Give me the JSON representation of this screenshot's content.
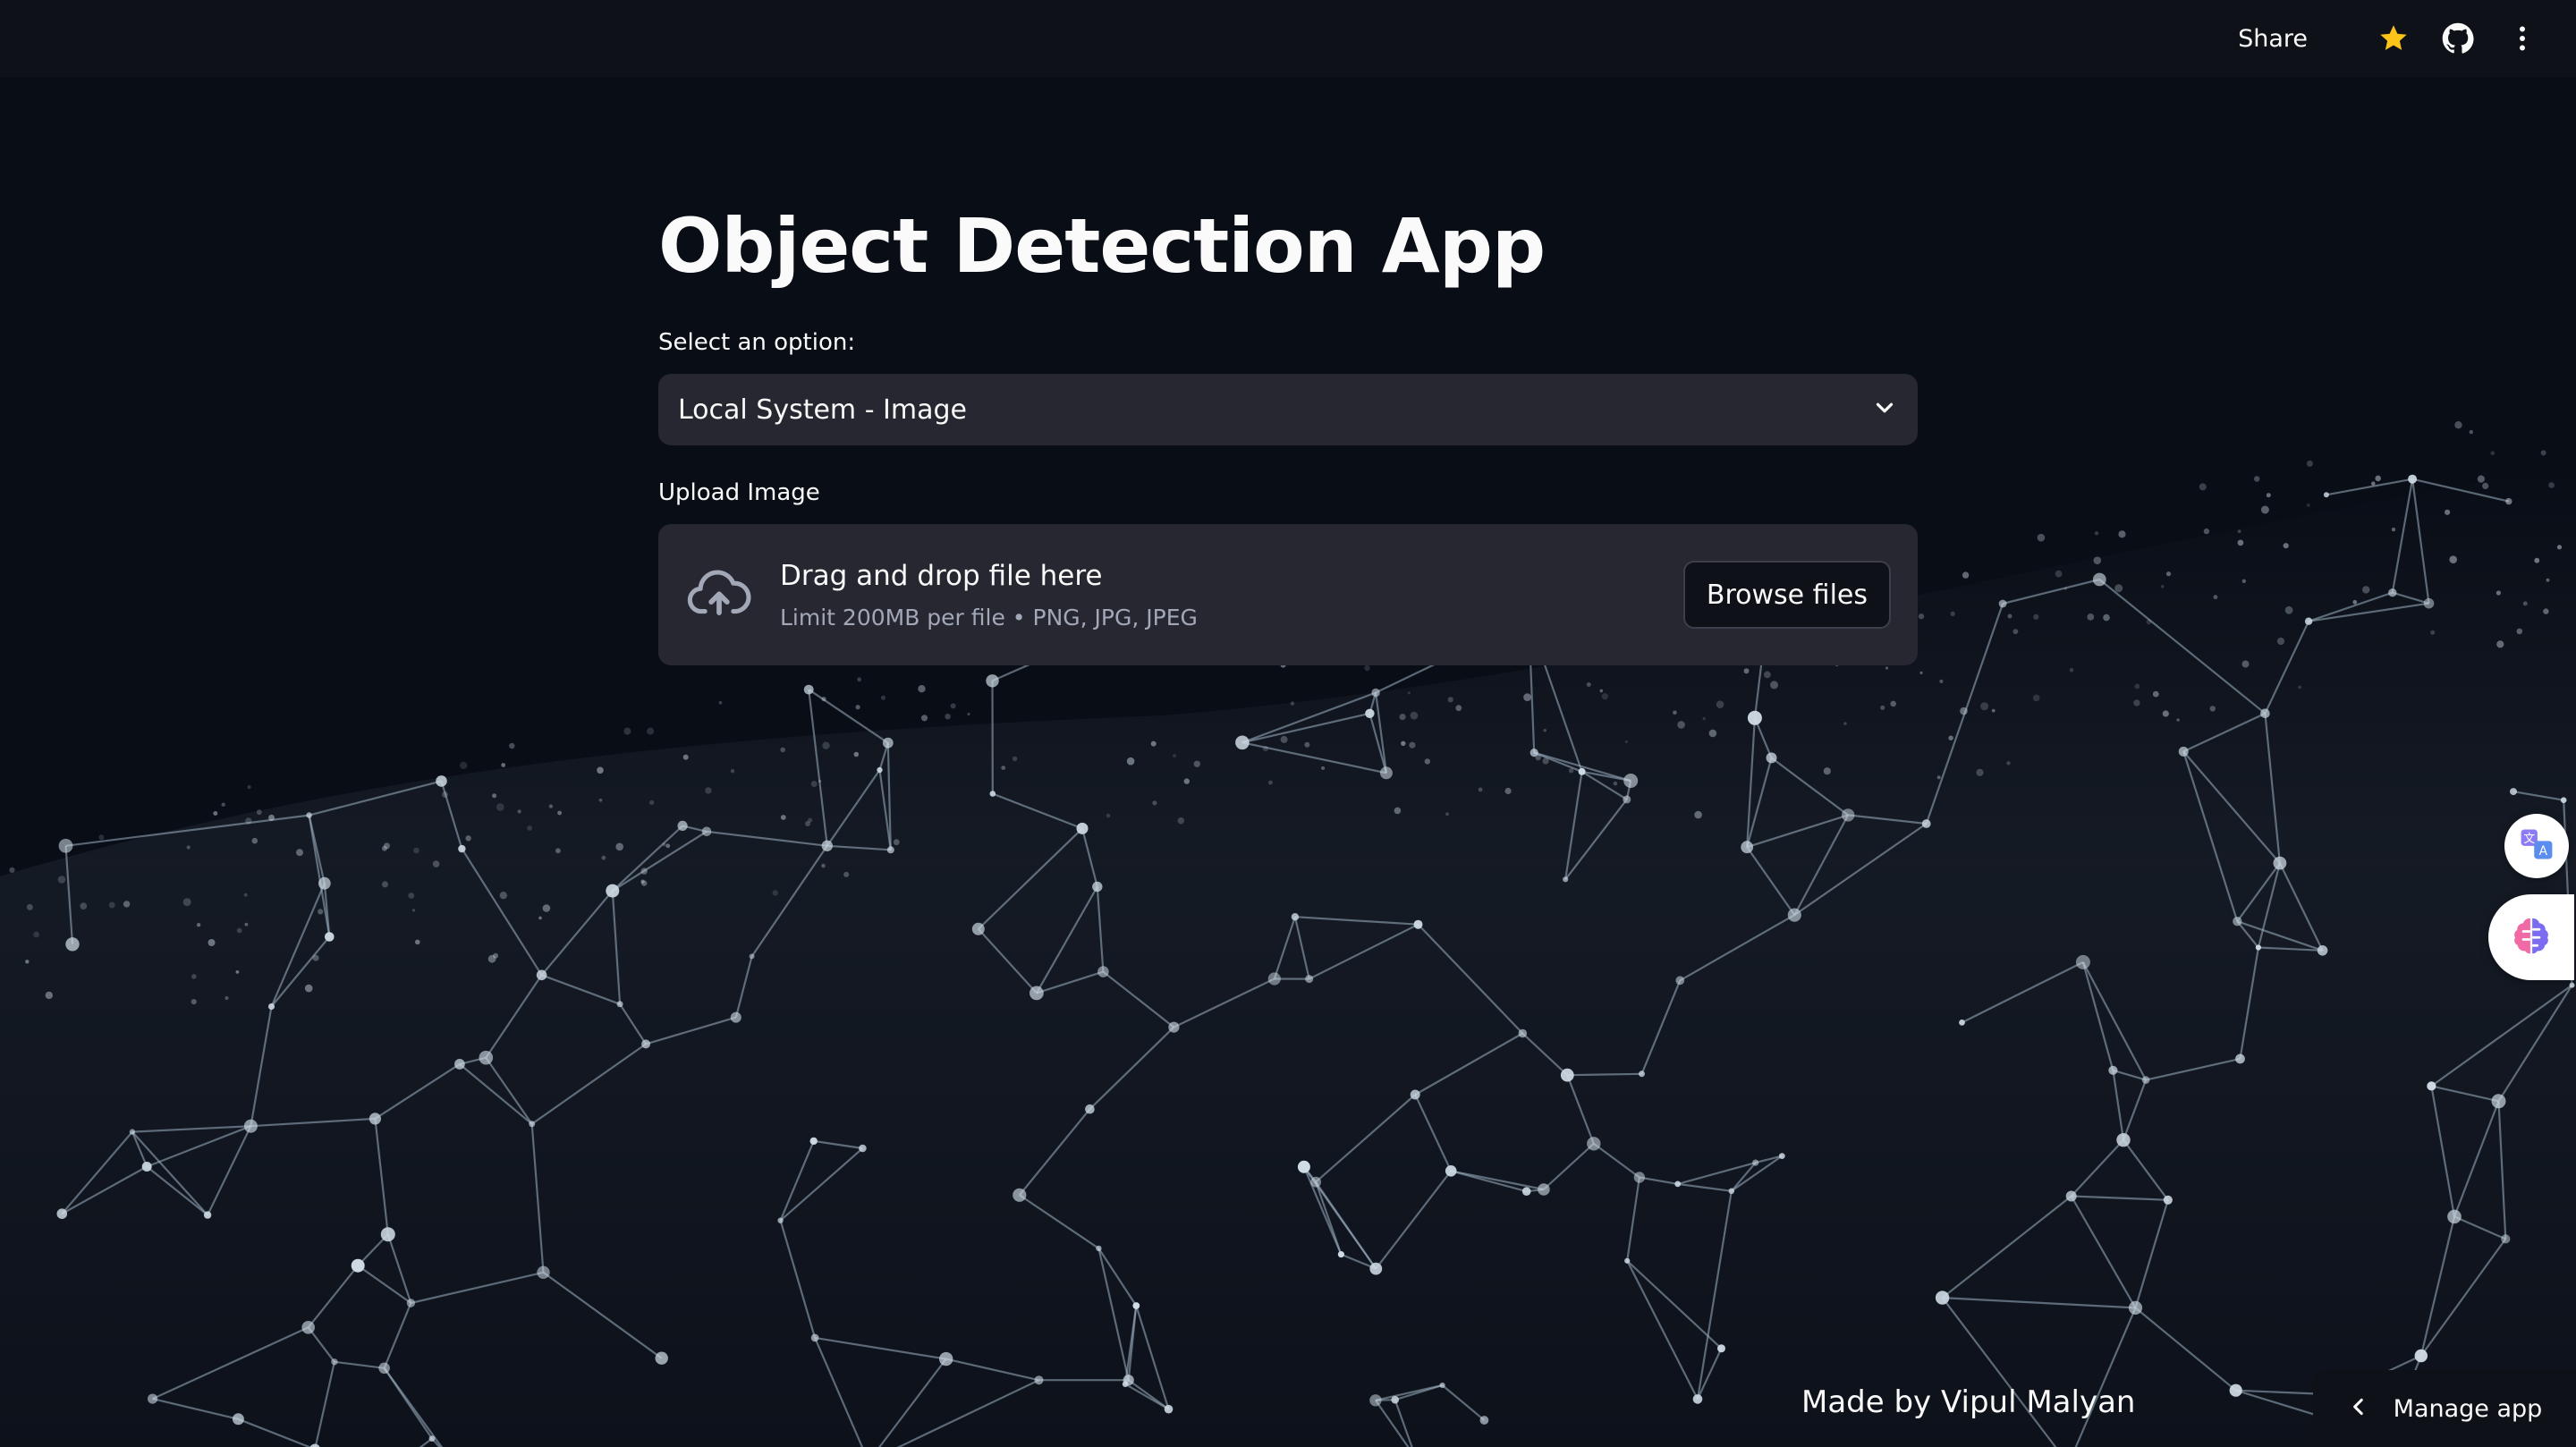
{
  "header": {
    "share_label": "Share",
    "icons": [
      "star-icon",
      "github-icon",
      "kebab-menu-icon"
    ]
  },
  "main": {
    "title": "Object Detection App",
    "select_label": "Select an option:",
    "select_value": "Local System - Image",
    "upload_label": "Upload Image",
    "drop_text": "Drag and drop file here",
    "limit_text": "Limit 200MB per file • PNG, JPG, JPEG",
    "browse_label": "Browse files"
  },
  "footer": {
    "credit": "Made by Vipul Malyan",
    "manage_label": "Manage app"
  },
  "side_widgets": [
    "translate-icon",
    "brain-icon"
  ],
  "colors": {
    "background": "#090d16",
    "header": "#0e1117",
    "widget": "#262730",
    "star": "#fcc419",
    "network": "#9fb3c4"
  }
}
